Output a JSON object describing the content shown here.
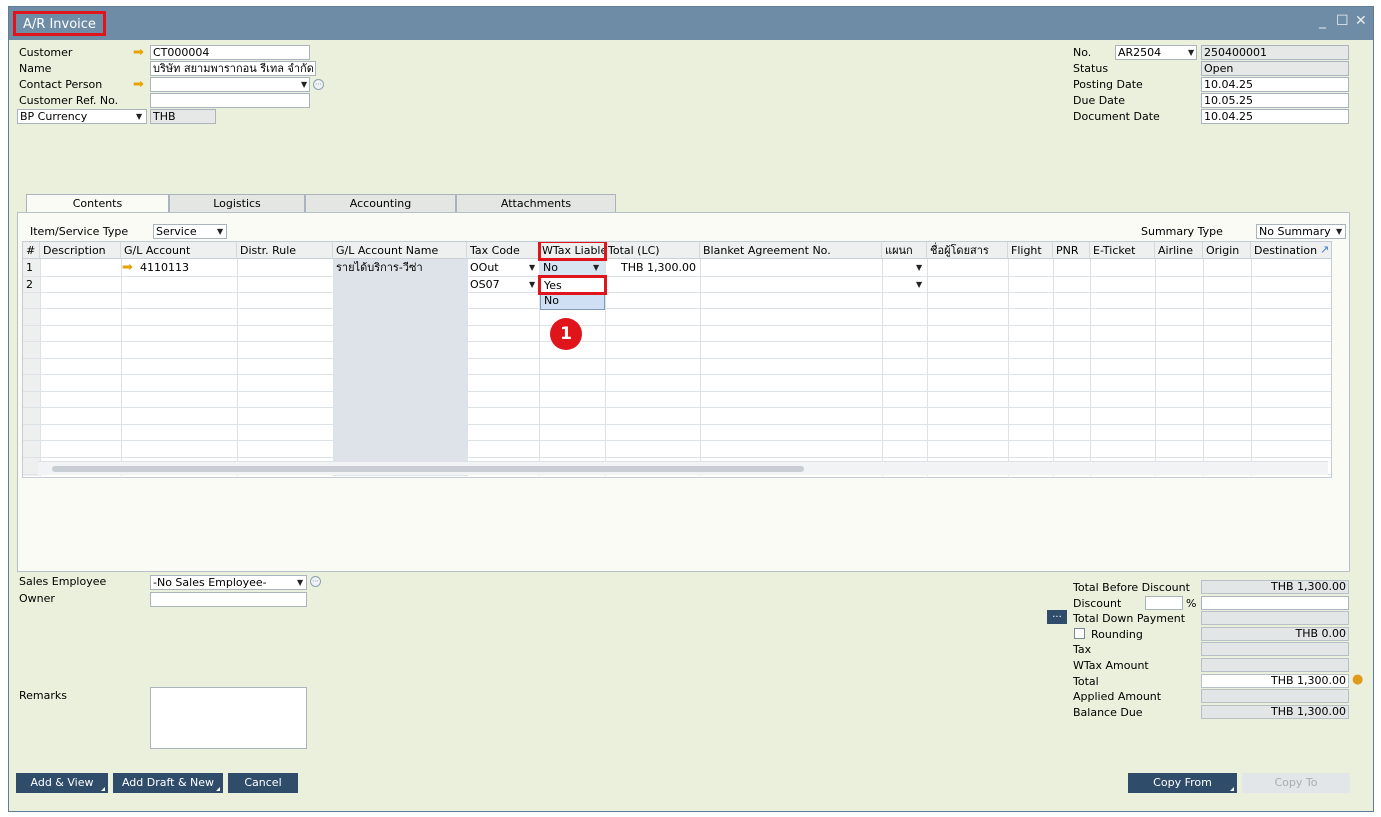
{
  "window": {
    "title": "A/R Invoice",
    "controls": [
      "_",
      "☐",
      "✕"
    ]
  },
  "header_left": {
    "customer_label": "Customer",
    "customer_value": "CT000004",
    "name_label": "Name",
    "name_value": "บริษัท สยามพารากอน รีเทล จำกัด",
    "contact_label": "Contact Person",
    "contact_value": "",
    "custref_label": "Customer Ref. No.",
    "custref_value": "",
    "currency_label": "BP Currency",
    "currency_value": "THB"
  },
  "header_right": {
    "no_label": "No.",
    "series_value": "AR2504",
    "no_value": "250400001",
    "status_label": "Status",
    "status_value": "Open",
    "posting_label": "Posting Date",
    "posting_value": "10.04.25",
    "due_label": "Due Date",
    "due_value": "10.05.25",
    "docdate_label": "Document Date",
    "docdate_value": "10.04.25"
  },
  "tabs": [
    "Contents",
    "Logistics",
    "Accounting",
    "Attachments"
  ],
  "contents": {
    "item_type_label": "Item/Service Type",
    "item_type_value": "Service",
    "summary_label": "Summary Type",
    "summary_value": "No Summary"
  },
  "grid": {
    "columns": [
      "#",
      "Description",
      "G/L Account",
      "Distr. Rule",
      "G/L Account Name",
      "Tax Code",
      "WTax Liable",
      "Total (LC)",
      "Blanket Agreement No.",
      "แผนก",
      "ชื่อผู้โดยสาร",
      "Flight",
      "PNR",
      "E-Ticket",
      "Airline",
      "Origin",
      "Destination"
    ],
    "rows": [
      {
        "num": "1",
        "gl_account": "4110113",
        "gl_name": "รายได้บริการ-วีซ่า",
        "tax_code": "OOut",
        "wtax": "No",
        "total": "THB 1,300.00"
      },
      {
        "num": "2",
        "gl_account": "",
        "gl_name": "",
        "tax_code": "OS07",
        "wtax": "",
        "total": ""
      }
    ],
    "dropdown_options": [
      "Yes",
      "No"
    ],
    "callout_number": "1"
  },
  "footer_left": {
    "sales_emp_label": "Sales Employee",
    "sales_emp_value": "-No Sales Employee-",
    "owner_label": "Owner",
    "owner_value": "",
    "remarks_label": "Remarks"
  },
  "totals": {
    "before_discount_label": "Total Before Discount",
    "before_discount_value": "THB 1,300.00",
    "discount_label": "Discount",
    "discount_pct_sign": "%",
    "down_payment_label": "Total Down Payment",
    "down_payment_btn": "...",
    "rounding_label": "Rounding",
    "rounding_value": "THB 0.00",
    "tax_label": "Tax",
    "wtax_amount_label": "WTax Amount",
    "total_label": "Total",
    "total_value": "THB 1,300.00",
    "applied_label": "Applied Amount",
    "balance_label": "Balance Due",
    "balance_value": "THB 1,300.00"
  },
  "buttons": {
    "add_view": "Add & View",
    "add_draft": "Add Draft & New",
    "cancel": "Cancel",
    "copy_from": "Copy From",
    "copy_to": "Copy To"
  },
  "colors": {
    "titlebar": "#6e8ca6",
    "window_bg": "#eaf0dc",
    "highlight": "#e0151b",
    "button": "#2f4d6b",
    "callout": "#e0151b"
  }
}
